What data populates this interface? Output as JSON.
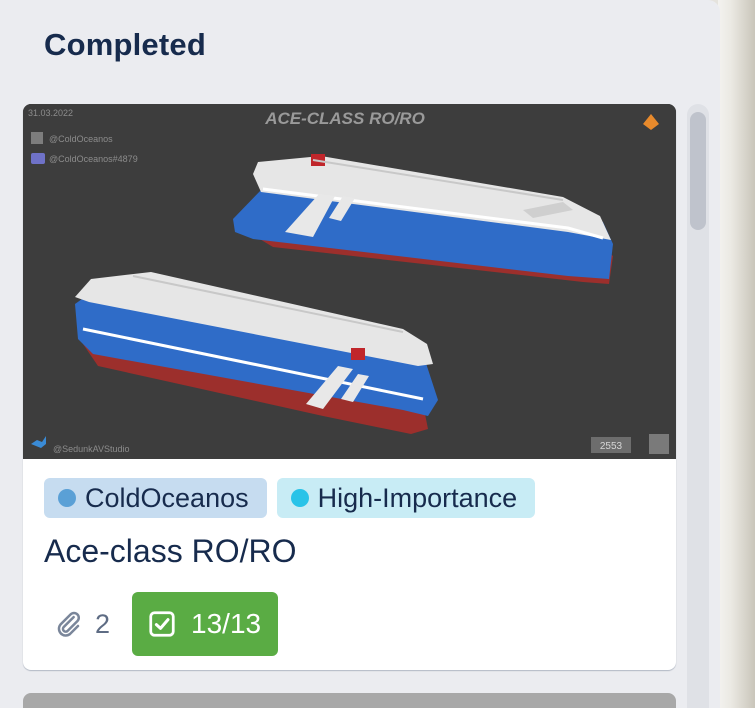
{
  "list": {
    "title": "Completed"
  },
  "card": {
    "cover": {
      "heading": "ACE-CLASS RO/RO",
      "date": "31.03.2022",
      "handle_1": "@ColdOceanos",
      "handle_2": "@ColdOceanos#4879",
      "handle_3": "@SedunkAVStudio",
      "badge": "2553"
    },
    "labels": [
      {
        "text": "ColdOceanos",
        "bg": "#c6dcf0",
        "dot": "#5aa0d6"
      },
      {
        "text": "High-Importance",
        "bg": "#c8ecf5",
        "dot": "#29c3e8"
      }
    ],
    "title": "Ace-class RO/RO",
    "attachments": "2",
    "checklist": {
      "text": "13/13",
      "color": "#5aac44"
    }
  }
}
